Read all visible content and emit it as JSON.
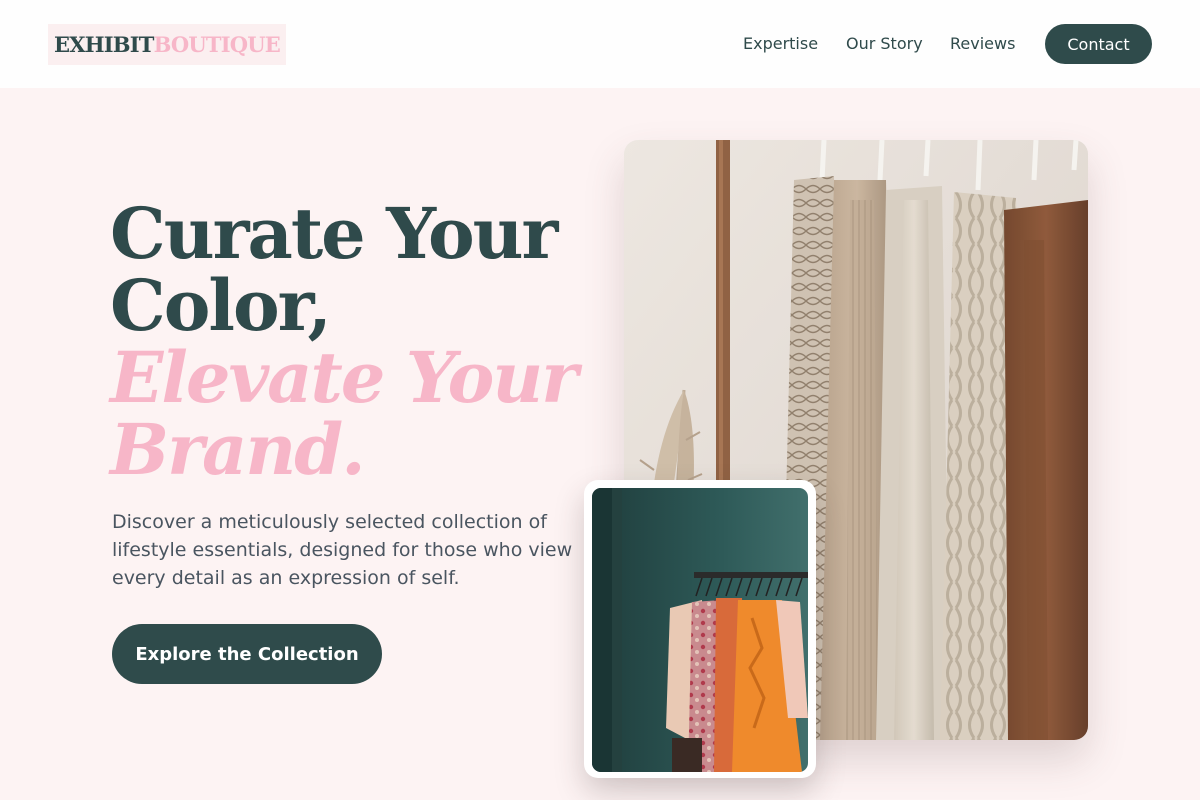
{
  "brand": {
    "part1": "EXHIBIT",
    "part2": "BOUTIQUE"
  },
  "nav": {
    "links": [
      "Expertise",
      "Our Story",
      "Reviews"
    ],
    "contact": "Contact"
  },
  "hero": {
    "headline_line1": "Curate Your",
    "headline_line2": "Color,",
    "headline_line3": "Elevate Your",
    "headline_line4": "Brand.",
    "intro": "Discover a meticulously selected collection of lifestyle essentials, designed for those who view every detail as an expression of self.",
    "cta": "Explore the Collection"
  },
  "colors": {
    "primary": "#2f4b4b",
    "accent_pink": "#f7b6c8",
    "background": "#fdf3f3"
  },
  "images": {
    "main": "clothing-rack-neutral-knits-photo",
    "inset": "boutique-rack-colorful-garments-photo"
  }
}
